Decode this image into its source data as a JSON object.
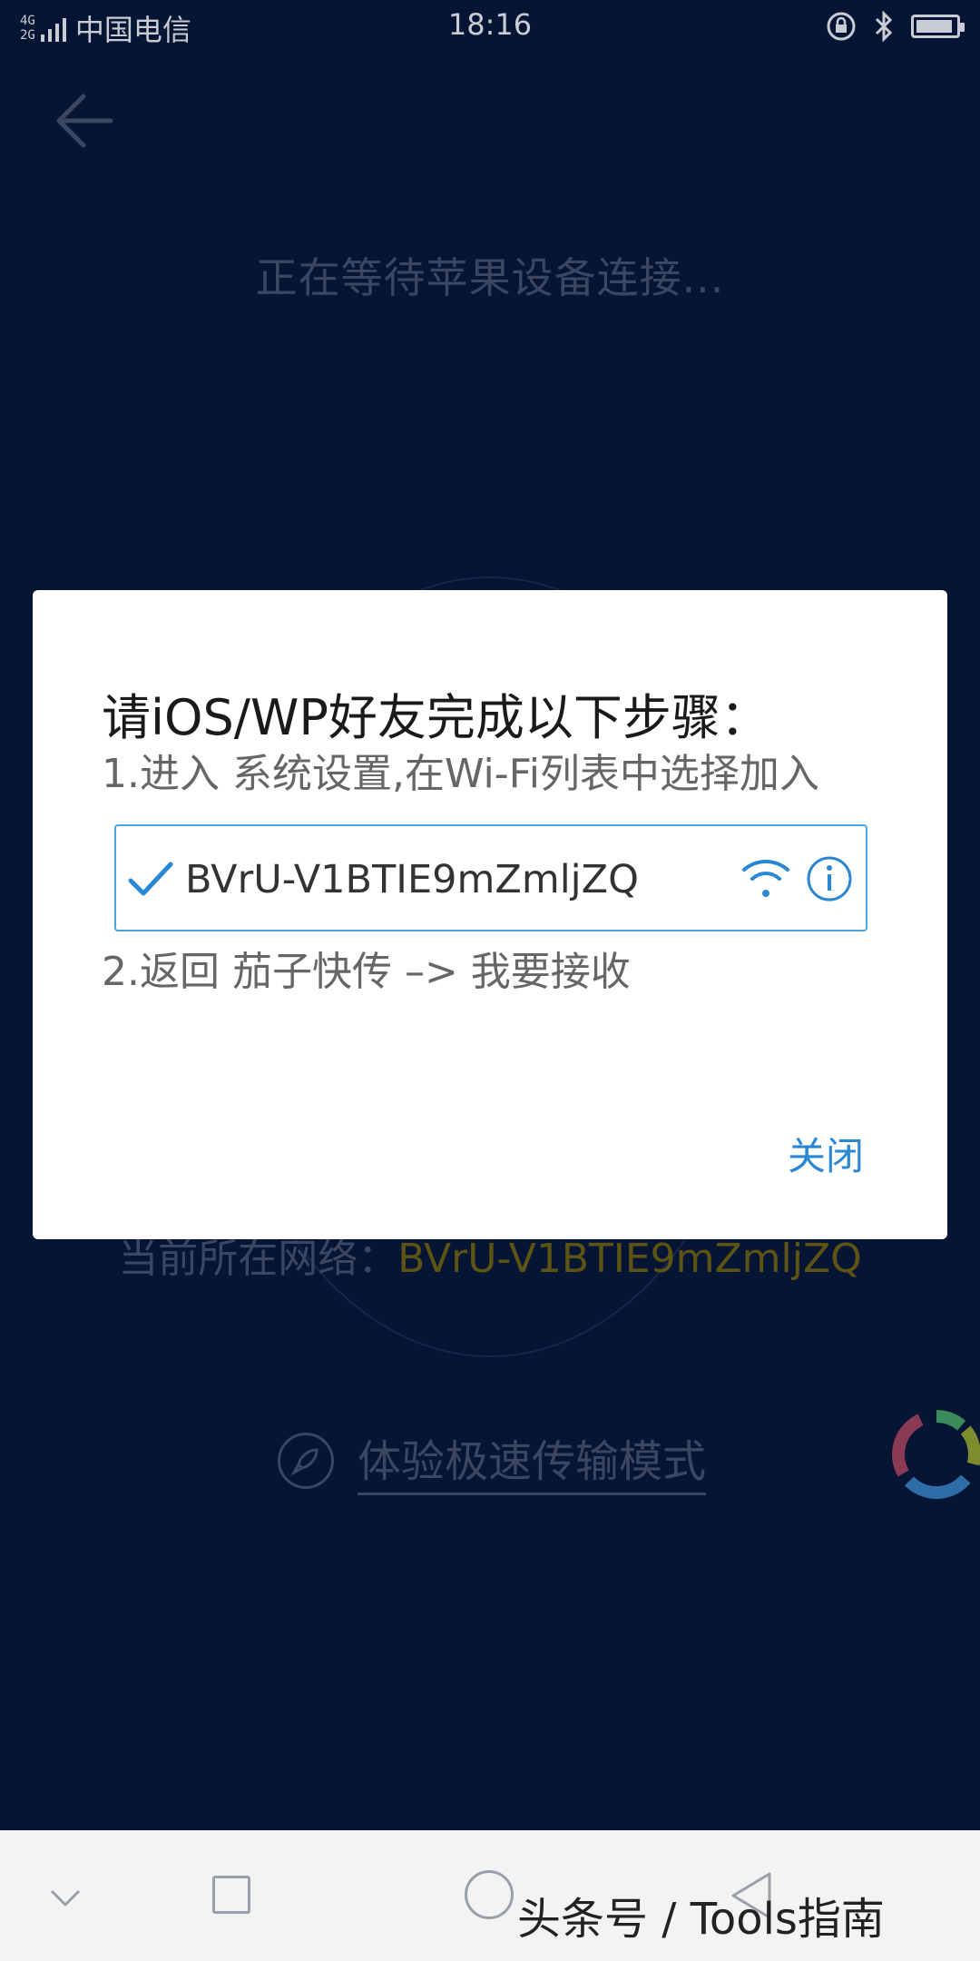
{
  "status_bar": {
    "network_top": "4G",
    "network_bottom": "2G",
    "carrier": "中国电信",
    "time": "18:16"
  },
  "background": {
    "waiting_text": "正在等待苹果设备连接...",
    "network_label": "当前所在网络：",
    "network_ssid": "BVrU-V1BTIE9mZmljZQ",
    "speed_mode_label": "体验极速传输模式"
  },
  "dialog": {
    "title": "请iOS/WP好友完成以下步骤：",
    "step1": "1.进入 系统设置,在Wi-Fi列表中选择加入",
    "wifi_ssid": "BVrU-V1BTIE9mZmljZQ",
    "step2": "2.返回 茄子快传 –> 我要接收",
    "close_label": "关闭"
  },
  "watermark": "头条号 / Tools指南",
  "colors": {
    "background": "#061534",
    "accent": "#2a87d3",
    "ssid_highlight": "#5d5413"
  }
}
